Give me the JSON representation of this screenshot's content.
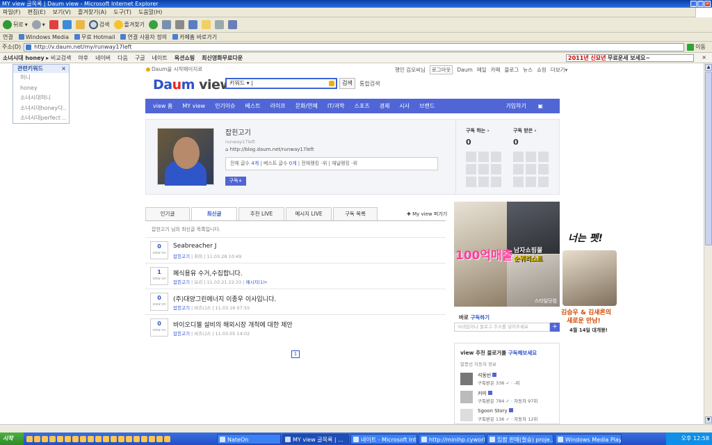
{
  "window": {
    "title": "MY view 글목록 | Daum view - Microsoft Internet Explorer"
  },
  "menu": [
    "파일(F)",
    "편집(E)",
    "보기(V)",
    "즐겨찾기(A)",
    "도구(T)",
    "도움말(H)"
  ],
  "toolbar": {
    "back": "뒤로",
    "search": "검색",
    "favorites": "즐겨찾기"
  },
  "links": {
    "label": "연결",
    "items": [
      "Windows Media",
      "무료 Hotmail",
      "연결 사용자 정의",
      "카페홈 바로가기"
    ]
  },
  "address": {
    "label": "주소(D)",
    "url": "http://v.daum.net/my/runway17left",
    "go": "이동"
  },
  "daumbar": {
    "search_label": "소녀시대 honey",
    "search_suffix": "비교검색",
    "items": [
      "야후",
      "네이버",
      "다음",
      "구글",
      "네이트",
      "옥션쇼핑",
      "최신영화무료다운"
    ],
    "ad_red": "2011년 신묘년",
    "ad_text": "무료운세 보세요~"
  },
  "keywords": {
    "title": "관련키워드",
    "items": [
      "허니",
      "honey",
      "소녀시대허니",
      "소녀시대honey다..",
      "소녀시대perfect .."
    ]
  },
  "header": {
    "start_page": "Daum을 시작페이지로",
    "user": "행인 김모씨님",
    "logout": "로그아웃",
    "links": [
      "Daum",
      "메일",
      "카페",
      "블로그",
      "뉴스",
      "쇼핑",
      "더보기"
    ],
    "search_placeholder": "키워드",
    "search_btn": "검색",
    "full_search": "통합검색"
  },
  "nav": {
    "items": [
      "view 홈",
      "MY view",
      "인기이슈",
      "베스트",
      "라이프",
      "문화/연예",
      "IT/과학",
      "스포츠",
      "경제",
      "시사",
      "브랜드"
    ],
    "join": "가입하기"
  },
  "profile": {
    "name": "잡힌고기",
    "id": "runway17left",
    "blog": "http://blog.daum.net/runway17left",
    "stats_label1": "전체 글수",
    "stats_val1": "4개",
    "stats_label2": "베스트 글수",
    "stats_val2": "0개",
    "stats_label3": "전체랭킹",
    "stats_val3": "-위",
    "stats_label4": "채널랭킹",
    "stats_val4": "-위",
    "subscribe_btn": "구독+",
    "sub_doing": "구독 하는",
    "sub_doing_count": "0",
    "sub_received": "구독 받은",
    "sub_received_count": "0"
  },
  "tabs": [
    "인기글",
    "최신글",
    "추천 LIVE",
    "메시지 LIVE",
    "구독 목록"
  ],
  "myview_share": "My view 퍼가기",
  "list_note": "잡힌고기 님의 최신글 목록입니다.",
  "posts": [
    {
      "count": "0",
      "title": "Seabreacher J",
      "author": "잡힌고기",
      "category": "취미",
      "date": "11.03.28 10:49",
      "extra": ""
    },
    {
      "count": "1",
      "title": "폐식용유 수거,수집합니다.",
      "author": "잡힌고기",
      "category": "요리",
      "date": "11.03.21 22:33",
      "extra": "메시지(1)"
    },
    {
      "count": "0",
      "title": "(주)대양그린에너지 이종우 이사입니다.",
      "author": "잡힌고기",
      "category": "비즈니스",
      "date": "11.03.16 07:55",
      "extra": ""
    },
    {
      "count": "0",
      "title": "바이오디젤 설비의 해외시장 개척에 대한 제안",
      "author": "잡힌고기",
      "category": "비즈니스",
      "date": "11.03.05 14:02",
      "extra": ""
    }
  ],
  "view_on_label": "view on",
  "pagination": "1",
  "ad": {
    "big": "100억매출",
    "sub1": "남자쇼핑몰",
    "sub2": "순위리스트",
    "brand": "스타일닷컴"
  },
  "direct_subscribe": {
    "label_pre": "바로",
    "label_em": "구독하기",
    "placeholder": "닉네임이나 블로그 주소를 넣어주세요"
  },
  "recommend": {
    "title_pre": "view 추천 블로거를",
    "title_em": "구독해보세요",
    "subtitle": "말풍선 자동차 정보",
    "items": [
      {
        "name": "석동빈",
        "subs": "구독받은 336",
        "rank": "-위"
      },
      {
        "name": "커미",
        "subs": "구독받은 784",
        "rank": "자동차 97위"
      },
      {
        "name": "Sgoon Story",
        "subs": "구독받은 136",
        "rank": "자동차 12위"
      }
    ]
  },
  "sidead": {
    "title": "너는 펫!",
    "line1": "김승우 & 김새론의",
    "line2": "새로운 만남!",
    "line3": "4월 14일 대개봉!"
  },
  "taskbar": {
    "start": "시작",
    "tasks": [
      "NateOn",
      "MY view 글목록 | ...",
      "네이트 - Microsoft Int...",
      "http://minihp.cyworl...",
      "임팝 판매(철숭) proje...",
      "Windows Media Player"
    ],
    "time": "오후 12:58"
  }
}
